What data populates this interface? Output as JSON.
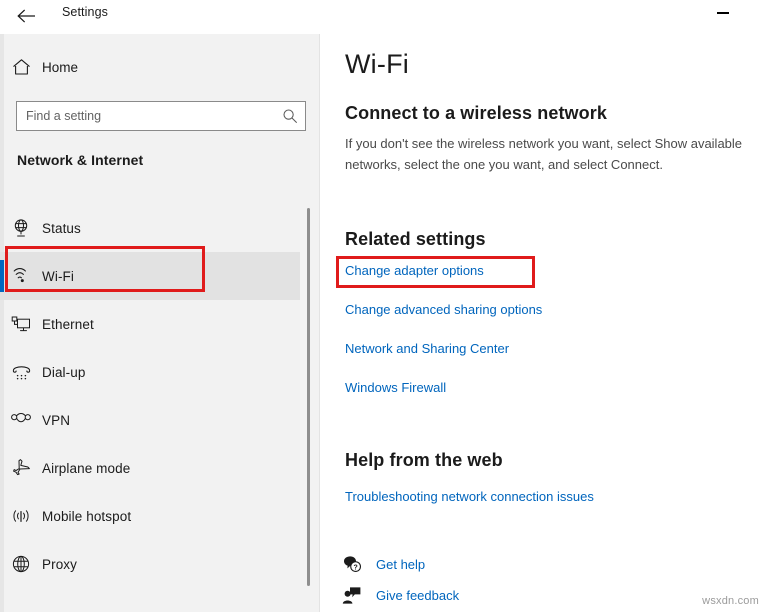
{
  "window": {
    "title": "Settings",
    "back_icon": "back-arrow-icon",
    "minimize_icon": "minimize-icon"
  },
  "sidebar": {
    "home": {
      "label": "Home",
      "icon": "home-icon"
    },
    "search": {
      "placeholder": "Find a setting",
      "value": "",
      "icon": "search-icon"
    },
    "category_title": "Network & Internet",
    "selected_item": "Wi-Fi",
    "items": [
      {
        "label": "Status",
        "icon": "status-globe-icon",
        "selected": false
      },
      {
        "label": "Wi-Fi",
        "icon": "wifi-icon",
        "selected": true
      },
      {
        "label": "Ethernet",
        "icon": "ethernet-icon",
        "selected": false
      },
      {
        "label": "Dial-up",
        "icon": "dialup-phone-icon",
        "selected": false
      },
      {
        "label": "VPN",
        "icon": "vpn-icon",
        "selected": false
      },
      {
        "label": "Airplane mode",
        "icon": "airplane-icon",
        "selected": false
      },
      {
        "label": "Mobile hotspot",
        "icon": "mobile-hotspot-icon",
        "selected": false
      },
      {
        "label": "Proxy",
        "icon": "proxy-globe-icon",
        "selected": false
      }
    ]
  },
  "main": {
    "page_title": "Wi-Fi",
    "connect": {
      "heading": "Connect to a wireless network",
      "description": "If you don't see the wireless network you want, select Show available\nnetworks, select the one you want, and select Connect."
    },
    "related": {
      "heading": "Related settings",
      "links": [
        {
          "label": "Change adapter options"
        },
        {
          "label": "Change advanced sharing options"
        },
        {
          "label": "Network and Sharing Center"
        },
        {
          "label": "Windows Firewall"
        }
      ]
    },
    "help": {
      "heading": "Help from the web",
      "links": [
        {
          "label": "Troubleshooting network connection issues"
        }
      ],
      "actions": [
        {
          "label": "Get help",
          "icon": "question-bubble-icon"
        },
        {
          "label": "Give feedback",
          "icon": "feedback-person-icon"
        }
      ]
    }
  },
  "annotations": [
    {
      "name": "wifi-highlight",
      "target": "Wi-Fi",
      "color": "#e01b1b"
    },
    {
      "name": "change-adapter-highlight",
      "target": "Change adapter options",
      "color": "#e01b1b"
    }
  ],
  "watermark": "wsxdn.com",
  "colors": {
    "accent": "#0067c0",
    "link": "#0065bd",
    "annotation": "#e01b1b",
    "sidebar_bg": "#f2f2f2",
    "main_bg": "#ffffff",
    "text": "#1b1b1b"
  }
}
